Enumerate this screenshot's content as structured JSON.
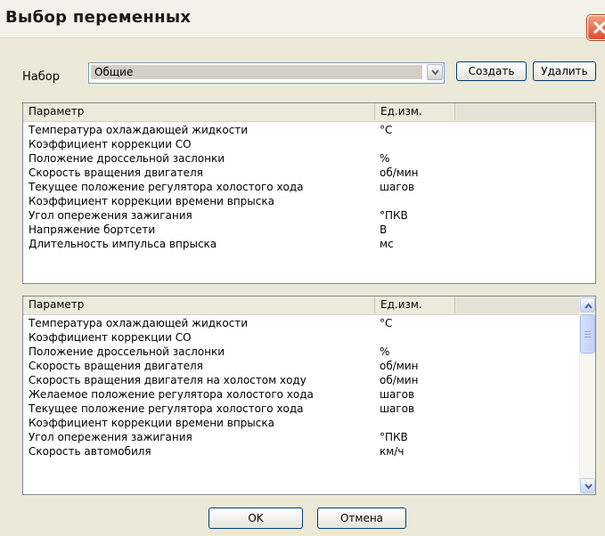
{
  "window": {
    "title": "Выбор переменных"
  },
  "set": {
    "label": "Набор",
    "value": "Общие"
  },
  "buttons": {
    "create": "Создать",
    "delete": "Удалить",
    "ok": "OK",
    "cancel": "Отмена"
  },
  "top_table": {
    "columns": [
      "Параметр",
      "Ед.изм."
    ],
    "rows": [
      [
        "Температура охлаждающей жидкости",
        "°С"
      ],
      [
        "Коэффициент коррекции СО",
        ""
      ],
      [
        "Положение дроссельной заслонки",
        "%"
      ],
      [
        "Скорость вращения двигателя",
        "об/мин"
      ],
      [
        "Текущее положение регулятора холостого хода",
        "шагов"
      ],
      [
        "Коэффициент коррекции времени впрыска",
        ""
      ],
      [
        "Угол опережения зажигания",
        "°ПКВ"
      ],
      [
        "Напряжение бортсети",
        "В"
      ],
      [
        "Длительность импульса впрыска",
        "мс"
      ]
    ]
  },
  "bottom_table": {
    "columns": [
      "Параметр",
      "Ед.изм."
    ],
    "rows": [
      [
        "Температура охлаждающей жидкости",
        "°С"
      ],
      [
        "Коэффициент коррекции СО",
        ""
      ],
      [
        "Положение дроссельной заслонки",
        "%"
      ],
      [
        "Скорость вращения двигателя",
        "об/мин"
      ],
      [
        "Скорость вращения двигателя на холостом ходу",
        "об/мин"
      ],
      [
        "Желаемое положение регулятора холостого хода",
        "шагов"
      ],
      [
        "Текущее положение регулятора холостого хода",
        "шагов"
      ],
      [
        "Коэффициент коррекции времени впрыска",
        ""
      ],
      [
        "Угол опережения зажигания",
        "°ПКВ"
      ],
      [
        "Скорость автомобиля",
        "км/ч"
      ]
    ]
  },
  "icons": {
    "close": "close-icon",
    "dropdown": "chevron-down-icon",
    "scroll_up": "chevron-up-icon",
    "scroll_down": "chevron-down-icon"
  }
}
